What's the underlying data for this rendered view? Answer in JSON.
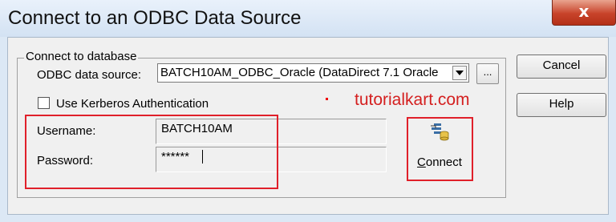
{
  "window": {
    "title": "Connect to an ODBC Data Source",
    "close_glyph": "x"
  },
  "group": {
    "legend": "Connect to database",
    "odbc_label": "ODBC data source:",
    "odbc_value": "BATCH10AM_ODBC_Oracle (DataDirect 7.1 Oracle",
    "browse_label": "...",
    "kerberos_label": "Use Kerberos Authentication",
    "kerberos_checked": false,
    "username_label": "Username:",
    "username_value": "BATCH10AM",
    "password_label": "Password:",
    "password_value": "******",
    "connect_label_underlined": "C",
    "connect_label_rest": "onnect"
  },
  "buttons": {
    "cancel": "Cancel",
    "help": "Help"
  },
  "watermark": "tutorialkart.com",
  "colors": {
    "highlight": "#e0202a",
    "watermark": "#d42020",
    "close_button": "#c8432a"
  },
  "icons": [
    "close-icon",
    "dropdown-arrow-icon",
    "database-connect-icon"
  ]
}
